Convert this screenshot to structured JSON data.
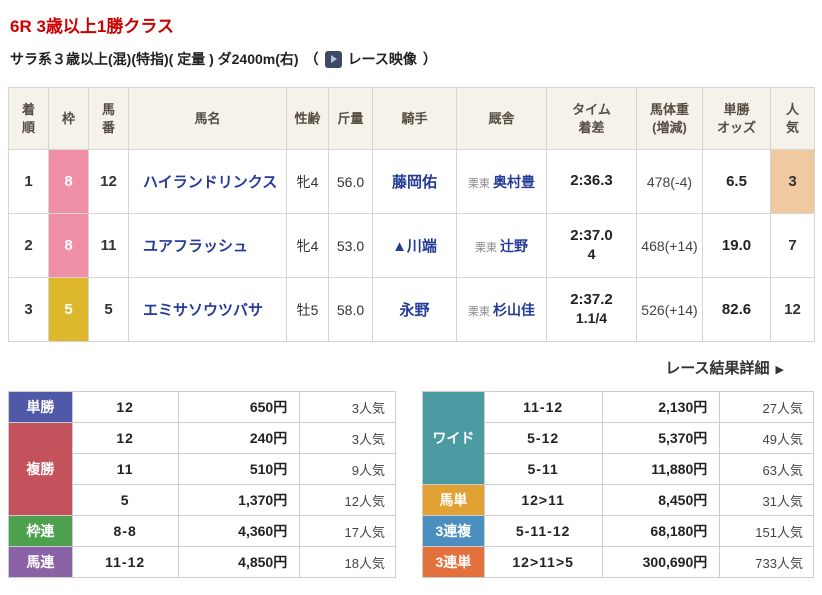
{
  "page": {
    "title": "6R 3歳以上1勝クラス",
    "conditions": "サラ系３歳以上(混)(特指)( 定量 ) ダ2400m(右)",
    "video": {
      "open": "（",
      "label": "レース映像",
      "close": "）"
    },
    "detail_link": "レース結果詳細",
    "detail_arrow": "▶"
  },
  "colors": {
    "title_red": "#cc0000",
    "link_blue": "#253b99",
    "waku_8_pink": "#ee8fa5",
    "waku_5_yellow": "#ddb82c",
    "pop_highlight": "#f0c9a1",
    "tansho": "#5059a8",
    "fukusho": "#c4525c",
    "wakuren": "#4da04d",
    "umaren": "#8a62a6",
    "wide": "#4b9ba3",
    "umatan": "#e2a233",
    "sanrenpuku": "#4a8fc0",
    "sanrentan": "#e2713b"
  },
  "results": {
    "headers": {
      "pos": [
        "着",
        "順"
      ],
      "waku": [
        "枠"
      ],
      "num": [
        "馬",
        "番"
      ],
      "name": [
        "馬名"
      ],
      "sexage": [
        "性齢"
      ],
      "weight": [
        "斤量"
      ],
      "jockey": [
        "騎手"
      ],
      "stable": [
        "厩舎"
      ],
      "time": [
        "タイム",
        "着差"
      ],
      "body": [
        "馬体重",
        "(増減)"
      ],
      "odds": [
        "単勝",
        "オッズ"
      ],
      "pop": [
        "人",
        "気"
      ]
    },
    "rows": [
      {
        "pos": "1",
        "waku": "8",
        "waku_color": "#ee8fa5",
        "num": "12",
        "horse": "ハイランドリンクス",
        "sexage": "牝4",
        "weight": "56.0",
        "jockey": "藤岡佑",
        "region": "栗東",
        "trainer": "奥村豊",
        "time": "2:36.3",
        "margin": "",
        "body": "478(-4)",
        "odds": "6.5",
        "pop": "3",
        "pop_bg": "#f0c9a1"
      },
      {
        "pos": "2",
        "waku": "8",
        "waku_color": "#ee8fa5",
        "num": "11",
        "horse": "ユアフラッシュ",
        "sexage": "牝4",
        "weight": "53.0",
        "jockey": "▲川端",
        "region": "栗東",
        "trainer": "辻野",
        "time": "2:37.0",
        "margin": "4",
        "body": "468(+14)",
        "odds": "19.0",
        "pop": "7",
        "pop_bg": ""
      },
      {
        "pos": "3",
        "waku": "5",
        "waku_color": "#ddb82c",
        "num": "5",
        "horse": "エミサソウツバサ",
        "sexage": "牡5",
        "weight": "58.0",
        "jockey": "永野",
        "region": "栗東",
        "trainer": "杉山佳",
        "time": "2:37.2",
        "margin": "1.1/4",
        "body": "526(+14)",
        "odds": "82.6",
        "pop": "12",
        "pop_bg": ""
      }
    ]
  },
  "payouts": {
    "left": {
      "rows": [
        {
          "label": "単勝",
          "color": "#5059a8",
          "combo": "12",
          "amount": "650円",
          "pop": "3人気"
        },
        {
          "label": "複勝",
          "color": "#c4525c",
          "combo": "12",
          "amount": "240円",
          "pop": "3人気"
        },
        {
          "combo": "11",
          "amount": "510円",
          "pop": "9人気"
        },
        {
          "combo": "5",
          "amount": "1,370円",
          "pop": "12人気"
        },
        {
          "label": "枠連",
          "color": "#4da04d",
          "combo": "8-8",
          "amount": "4,360円",
          "pop": "17人気"
        },
        {
          "label": "馬連",
          "color": "#8a62a6",
          "combo": "11-12",
          "amount": "4,850円",
          "pop": "18人気"
        }
      ]
    },
    "right": {
      "rows": [
        {
          "label": "ワイド",
          "color": "#4b9ba3",
          "combo": "11-12",
          "amount": "2,130円",
          "pop": "27人気"
        },
        {
          "combo": "5-12",
          "amount": "5,370円",
          "pop": "49人気"
        },
        {
          "combo": "5-11",
          "amount": "11,880円",
          "pop": "63人気"
        },
        {
          "label": "馬単",
          "color": "#e2a233",
          "combo": "12>11",
          "amount": "8,450円",
          "pop": "31人気"
        },
        {
          "label": "3連複",
          "color": "#4a8fc0",
          "combo": "5-11-12",
          "amount": "68,180円",
          "pop": "151人気"
        },
        {
          "label": "3連単",
          "color": "#e2713b",
          "combo": "12>11>5",
          "amount": "300,690円",
          "pop": "733人気"
        }
      ]
    }
  }
}
